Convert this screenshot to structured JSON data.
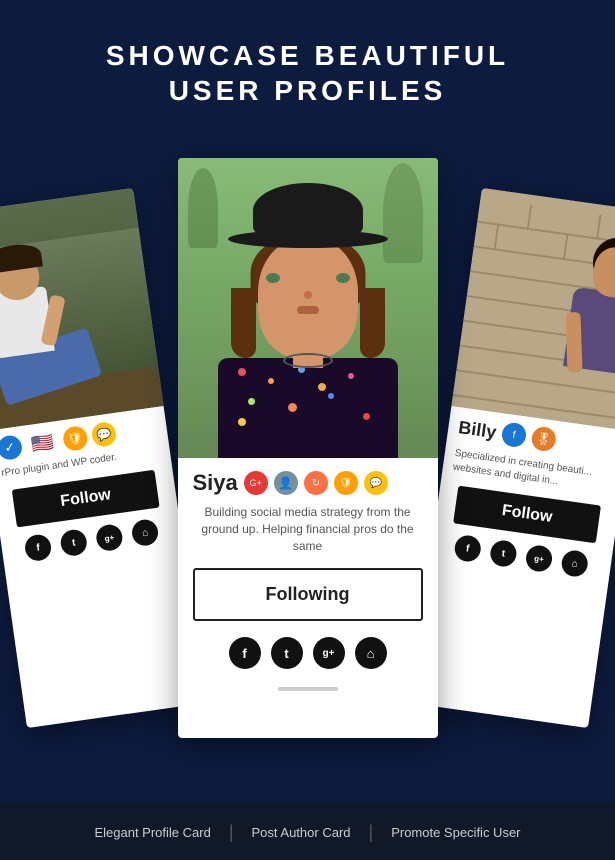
{
  "header": {
    "line1": "SHOWCASE BEAUTIFUL",
    "line2": "USER PROFILES"
  },
  "cards": {
    "center": {
      "name": "Siya",
      "bio": "Building social media strategy from the ground up. Helping financial pros do the same",
      "button_label": "Following",
      "badges": [
        {
          "type": "red",
          "symbol": "G+"
        },
        {
          "type": "gray",
          "symbol": "👤"
        },
        {
          "type": "orange",
          "symbol": "🔄"
        },
        {
          "type": "amber",
          "symbol": "🛡"
        },
        {
          "type": "yellow",
          "symbol": "💬"
        }
      ],
      "social": [
        {
          "platform": "facebook",
          "symbol": "f"
        },
        {
          "platform": "twitter",
          "symbol": "t"
        },
        {
          "platform": "googleplus",
          "symbol": "g+"
        },
        {
          "platform": "home",
          "symbol": "⌂"
        }
      ]
    },
    "left": {
      "name": "",
      "bio": "rPro plugin and WP coder.",
      "button_label": "Follow",
      "badges": [
        {
          "type": "check",
          "symbol": "✓"
        },
        {
          "type": "flag",
          "symbol": "🇺🇸"
        },
        {
          "type": "amber",
          "symbol": "🛡"
        },
        {
          "type": "yellow",
          "symbol": "💬"
        }
      ],
      "social": [
        {
          "platform": "facebook",
          "symbol": "f"
        },
        {
          "platform": "twitter",
          "symbol": "t"
        },
        {
          "platform": "googleplus",
          "symbol": "g+"
        },
        {
          "platform": "home",
          "symbol": "⌂"
        }
      ]
    },
    "right": {
      "name": "Billy",
      "bio": "Specialized in creating beauti... websites and digital in...",
      "button_label": "Follow",
      "badges": [
        {
          "type": "blue",
          "symbol": "f"
        },
        {
          "type": "orange",
          "symbol": "🎖"
        }
      ],
      "social": [
        {
          "platform": "facebook",
          "symbol": "f"
        },
        {
          "platform": "twitter",
          "symbol": "t"
        },
        {
          "platform": "googleplus",
          "symbol": "g+"
        },
        {
          "platform": "home",
          "symbol": "⌂"
        }
      ]
    }
  },
  "footer": {
    "items": [
      "Elegant Profile Card",
      "Post Author Card",
      "Promote Specific User"
    ],
    "divider": "|"
  }
}
